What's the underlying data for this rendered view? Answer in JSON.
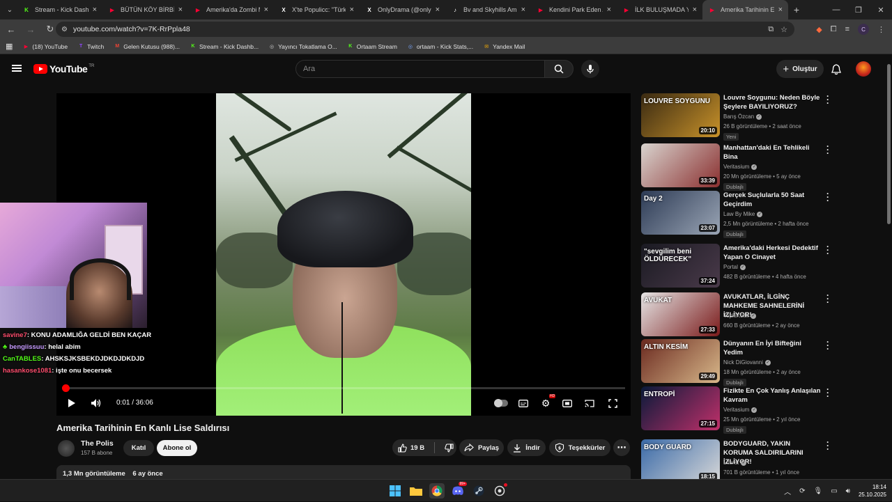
{
  "browser": {
    "tabs": [
      {
        "label": "Stream - Kick Dashboard",
        "fav": "K",
        "color": "#53fc18"
      },
      {
        "label": "BÜTÜN KÖY BİRBİRİNE",
        "fav": "▶",
        "color": "#ff0033"
      },
      {
        "label": "Amerika'da Zombi M",
        "fav": "▶",
        "color": "#ff0033"
      },
      {
        "label": "X'te Populicc: \"Türk d",
        "fav": "X",
        "color": "#ffffff"
      },
      {
        "label": "OnlyDrama (@onlyd",
        "fav": "X",
        "color": "#ffffff"
      },
      {
        "label": "Bv and Skyhills Ambu",
        "fav": "♪",
        "color": "#ffffff"
      },
      {
        "label": "Kendini Park Eden Ar",
        "fav": "▶",
        "color": "#ff0033"
      },
      {
        "label": "İLK BULUŞMADA YAP",
        "fav": "▶",
        "color": "#ff0033"
      },
      {
        "label": "Amerika Tarihinin En",
        "fav": "▶",
        "color": "#ff0033",
        "active": true
      }
    ],
    "url": "youtube.com/watch?v=7K-RrPpla48",
    "bookmarks": [
      {
        "label": "(18) YouTube",
        "fav": "▶",
        "color": "#ff0033"
      },
      {
        "label": "Twitch",
        "fav": "T",
        "color": "#9146ff"
      },
      {
        "label": "Gelen Kutusu (988)...",
        "fav": "M",
        "color": "#ea4335"
      },
      {
        "label": "Stream - Kick Dashb...",
        "fav": "K",
        "color": "#53fc18"
      },
      {
        "label": "Yayıncı Tokatlama O...",
        "fav": "◎",
        "color": "#cccccc"
      },
      {
        "label": "Ortaam Stream",
        "fav": "K",
        "color": "#53fc18"
      },
      {
        "label": "ortaam - Kick Stats,...",
        "fav": "◎",
        "color": "#7aa7ff"
      },
      {
        "label": "Yandex Mail",
        "fav": "✉",
        "color": "#ffb300"
      }
    ]
  },
  "header": {
    "logo_text": "YouTube",
    "logo_sup": "TR",
    "search_placeholder": "Ara",
    "create_label": "Oluştur"
  },
  "player": {
    "time": "0:01 / 36:06",
    "progress": 0.0005
  },
  "chat": [
    {
      "user": "savine7",
      "color": "#ff4d6d",
      "msg": ": KONU ADAMLIĞA GELDİ BEN KAÇAR"
    },
    {
      "user": "bengiissuu",
      "color": "#c69bff",
      "msg": ": helal abim",
      "badge": "♣"
    },
    {
      "user": "CanTABLES",
      "color": "#53fc18",
      "msg": ": AHSKSJKSBEKDJDKDJDKDJD"
    },
    {
      "user": "hasankose1081",
      "color": "#ff4d6d",
      "msg": ": işte onu becersek"
    }
  ],
  "video": {
    "title": "Amerika Tarihinin En Kanlı Lise Saldırısı",
    "channel": "The Polis",
    "subscribers": "157 B abone",
    "join_label": "Katıl",
    "subscribe_label": "Abone ol",
    "likes": "19 B",
    "share_label": "Paylaş",
    "download_label": "İndir",
    "thanks_label": "Teşekkürler",
    "views": "1,3 Mn görüntüleme",
    "age": "6 ay önce"
  },
  "recommendations": [
    {
      "title": "Louvre Soygunu: Neden Böyle Şeylere BAYILIYORUZ?",
      "channel": "Barış Özcan",
      "meta": "26 B görüntüleme • 2 saat önce",
      "duration": "20:10",
      "badge": "Yeni",
      "thumb_text": "LOUVRE SOYGUNU",
      "colors": [
        "#3a2a12",
        "#c8922a"
      ]
    },
    {
      "title": "Manhattan'daki En Tehlikeli Bina",
      "channel": "Veritasium",
      "meta": "20 Mn görüntüleme • 5 ay önce",
      "duration": "33:39",
      "badge": "Dublajlı",
      "thumb_text": "",
      "colors": [
        "#d9d4cf",
        "#8a2f2f"
      ]
    },
    {
      "title": "Gerçek Suçlularla 50 Saat Geçirdim",
      "channel": "Law By Mike",
      "meta": "2,5 Mn görüntüleme • 2 hafta önce",
      "duration": "23:07",
      "badge": "Dublajlı",
      "thumb_text": "Day 2",
      "colors": [
        "#2d3b55",
        "#9aa5b5"
      ]
    },
    {
      "title": "Amerika'daki Herkesi Dedektif Yapan O Cinayet",
      "channel": "Portal",
      "meta": "482 B görüntüleme • 4 hafta önce",
      "duration": "37:24",
      "badge": "",
      "thumb_text": "\"sevgilim beni ÖLDÜRECEK\"",
      "colors": [
        "#1a1a22",
        "#4a3a4a"
      ]
    },
    {
      "title": "AVUKATLAR, İLGİNÇ MAHKEME SAHNELERİNİ İZLİYOR!",
      "channel": "TepkiKolik",
      "meta": "660 B görüntüleme • 2 ay önce",
      "duration": "27:33",
      "badge": "",
      "thumb_text": "AVUKAT",
      "colors": [
        "#e6e6e6",
        "#7a1a1a"
      ]
    },
    {
      "title": "Dünyanın En İyi Bifteğini Yedim",
      "channel": "Nick DiGiovanni",
      "meta": "18 Mn görüntüleme • 2 ay önce",
      "duration": "29:49",
      "badge": "Dublajlı",
      "thumb_text": "ALTIN KESİM",
      "colors": [
        "#6b2a20",
        "#d8b88a"
      ]
    },
    {
      "title": "Fizikte En Çok Yanlış Anlaşılan Kavram",
      "channel": "Veritasium",
      "meta": "25 Mn görüntüleme • 2 yıl önce",
      "duration": "27:15",
      "badge": "Dublajlı",
      "thumb_text": "ENTROPİ",
      "colors": [
        "#0a1a3a",
        "#c0306a"
      ]
    },
    {
      "title": "BODYGUARD, YAKIN KORUMA SALDIRILARINI İZLİYOR!",
      "channel": "Literat",
      "meta": "701 B görüntüleme • 1 yıl önce",
      "duration": "18:15",
      "badge": "",
      "thumb_text": "BODY GUARD",
      "colors": [
        "#3a6aa8",
        "#d8d8d8"
      ]
    }
  ],
  "taskbar": {
    "time": "18:14",
    "date": "25.10.2025"
  }
}
